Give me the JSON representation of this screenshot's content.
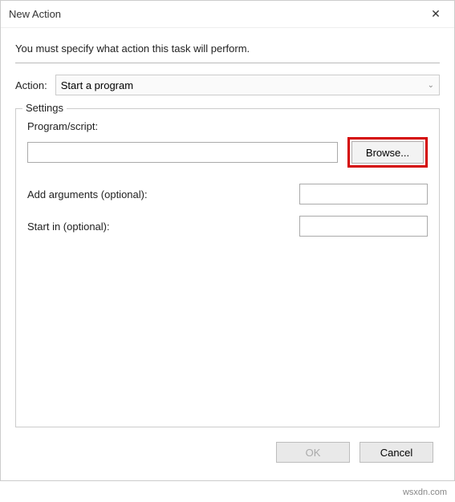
{
  "window": {
    "title": "New Action"
  },
  "instruction": "You must specify what action this task will perform.",
  "action": {
    "label": "Action:",
    "selected": "Start a program"
  },
  "settings": {
    "legend": "Settings",
    "program_label": "Program/script:",
    "program_value": "",
    "browse_label": "Browse...",
    "arguments_label": "Add arguments (optional):",
    "arguments_value": "",
    "startin_label": "Start in (optional):",
    "startin_value": ""
  },
  "buttons": {
    "ok": "OK",
    "cancel": "Cancel"
  },
  "watermark": "wsxdn.com"
}
